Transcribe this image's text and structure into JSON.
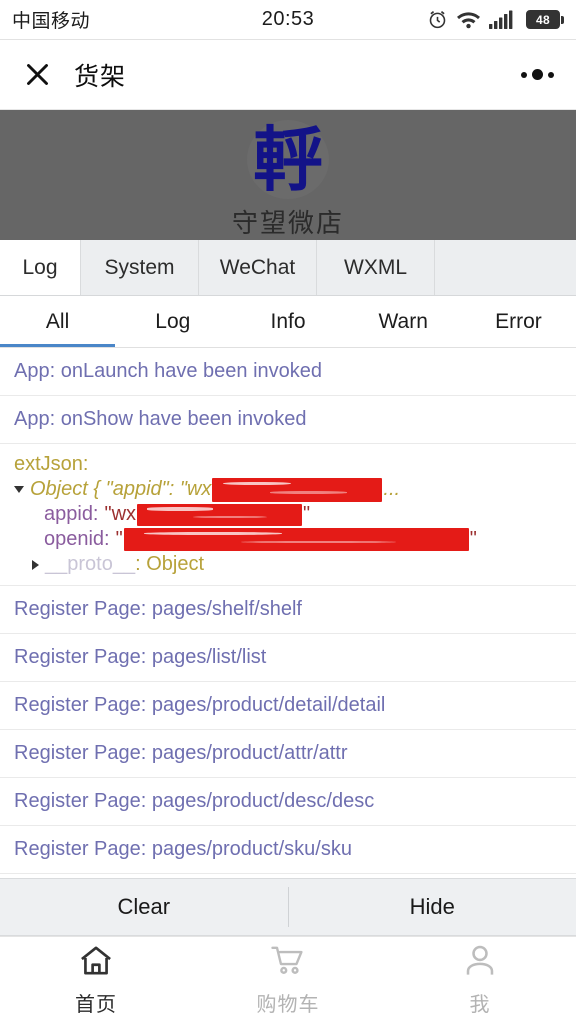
{
  "statusbar": {
    "carrier": "中国移动",
    "time": "20:53",
    "battery_level": "48",
    "icons": [
      "alarm-clock-icon",
      "wifi-icon",
      "cellular-signal-icon",
      "battery-icon"
    ]
  },
  "navbar": {
    "close_icon": "close-icon",
    "title": "货架",
    "more_icon": "more-options-icon"
  },
  "hero": {
    "logo_icon": "shop-logo-icon",
    "shop_name": "守望微店",
    "background_color": "#666666",
    "logo_color": "#131388"
  },
  "console": {
    "tabs": [
      {
        "label": "Log",
        "active": true
      },
      {
        "label": "System",
        "active": false
      },
      {
        "label": "WeChat",
        "active": false
      },
      {
        "label": "WXML",
        "active": false
      }
    ],
    "filters": [
      {
        "label": "All",
        "active": true
      },
      {
        "label": "Log",
        "active": false
      },
      {
        "label": "Info",
        "active": false
      },
      {
        "label": "Warn",
        "active": false
      },
      {
        "label": "Error",
        "active": false
      }
    ],
    "active_filter_color": "#4a86c8",
    "log_text_color": "#6f6fb0",
    "key_color": "#b7a23a",
    "redaction_color": "#e41b17",
    "entries": [
      {
        "text": "App: onLaunch have been invoked"
      },
      {
        "text": "App: onShow have been invoked"
      }
    ],
    "ext_json": {
      "label": "extJson:",
      "object_prefix": "Object { \"appid\": \"wx",
      "object_suffix": "...",
      "properties": [
        {
          "key": "appid:",
          "value_prefix": "\"wx",
          "value_suffix": "\"",
          "redacted": true
        },
        {
          "key": "openid:",
          "value_prefix": "\"",
          "value_suffix": "\"",
          "redacted": true
        }
      ],
      "proto_key": "__proto__",
      "proto_value": ": Object"
    },
    "register_pages": [
      "Register Page: pages/shelf/shelf",
      "Register Page: pages/list/list",
      "Register Page: pages/product/detail/detail",
      "Register Page: pages/product/attr/attr",
      "Register Page: pages/product/desc/desc",
      "Register Page: pages/product/sku/sku"
    ],
    "actions": {
      "clear_label": "Clear",
      "hide_label": "Hide"
    }
  },
  "tabbar": {
    "items": [
      {
        "label": "首页",
        "icon": "home-icon",
        "active": true
      },
      {
        "label": "购物车",
        "icon": "cart-icon",
        "active": false
      },
      {
        "label": "我",
        "icon": "person-icon",
        "active": false
      }
    ]
  }
}
